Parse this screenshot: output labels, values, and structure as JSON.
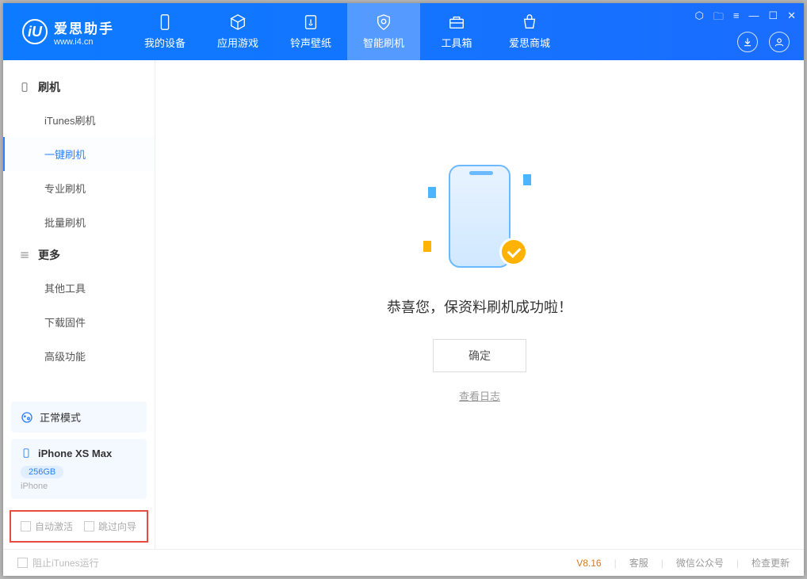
{
  "logo": {
    "cn": "爱思助手",
    "en": "www.i4.cn",
    "badge": "iU"
  },
  "tabs": {
    "t0": "我的设备",
    "t1": "应用游戏",
    "t2": "铃声壁纸",
    "t3": "智能刷机",
    "t4": "工具箱",
    "t5": "爱思商城"
  },
  "nav": {
    "group1": "刷机",
    "i0": "iTunes刷机",
    "i1": "一键刷机",
    "i2": "专业刷机",
    "i3": "批量刷机",
    "group2": "更多",
    "i4": "其他工具",
    "i5": "下载固件",
    "i6": "高级功能"
  },
  "device": {
    "mode": "正常模式",
    "name": "iPhone XS Max",
    "storage": "256GB",
    "type": "iPhone"
  },
  "options": {
    "auto": "自动激活",
    "skip": "跳过向导"
  },
  "main": {
    "success": "恭喜您，保资料刷机成功啦！",
    "ok": "确定",
    "log": "查看日志"
  },
  "footer": {
    "block": "阻止iTunes运行",
    "version": "V8.16",
    "kf": "客服",
    "wx": "微信公众号",
    "update": "检查更新"
  }
}
